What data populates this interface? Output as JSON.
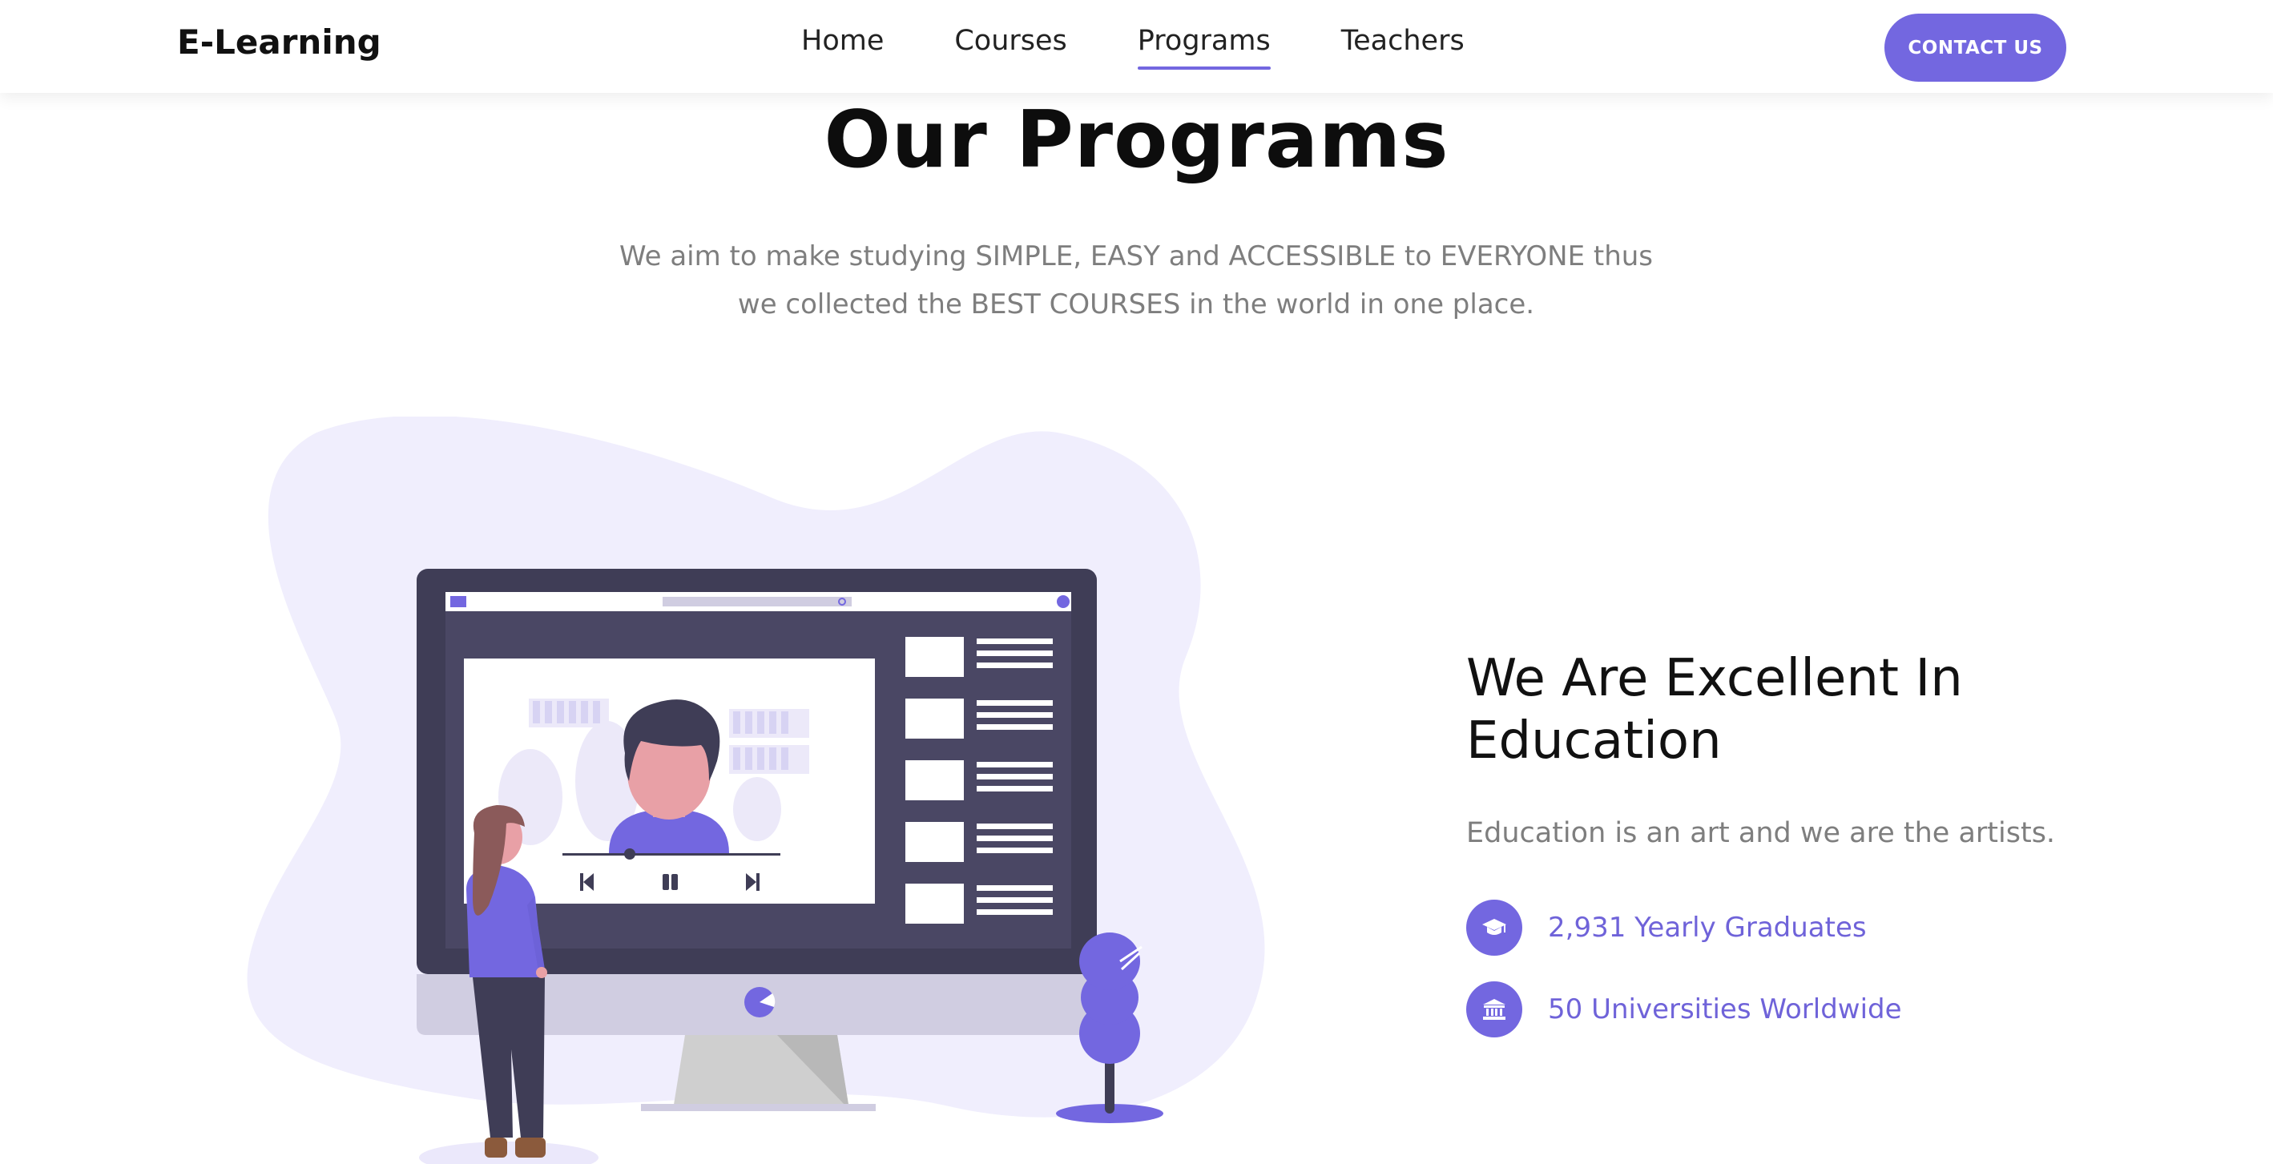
{
  "header": {
    "logo": "E-Learning",
    "nav": [
      {
        "label": "Home",
        "active": false
      },
      {
        "label": "Courses",
        "active": false
      },
      {
        "label": "Programs",
        "active": true
      },
      {
        "label": "Teachers",
        "active": false
      }
    ],
    "contact_label": "CONTACT US"
  },
  "programs": {
    "title": "Our Programs",
    "subtitle_line1": "We aim to make studying SIMPLE, EASY and ACCESSIBLE to EVERYONE thus",
    "subtitle_line2": "we collected the BEST COURSES in the world in one place."
  },
  "excellence": {
    "heading_line1": "We Are Excellent In",
    "heading_line2": "Education",
    "text": "Education is an art and we are the artists.",
    "stats": [
      {
        "icon": "graduation-cap-icon",
        "label": "2,931 Yearly Graduates"
      },
      {
        "icon": "university-icon",
        "label": "50 Universities Worldwide"
      }
    ]
  },
  "colors": {
    "accent": "#7367e0",
    "blob": "#f0eefd",
    "monitor_frame": "#3f3d56",
    "text_muted": "#7e7e7e"
  }
}
